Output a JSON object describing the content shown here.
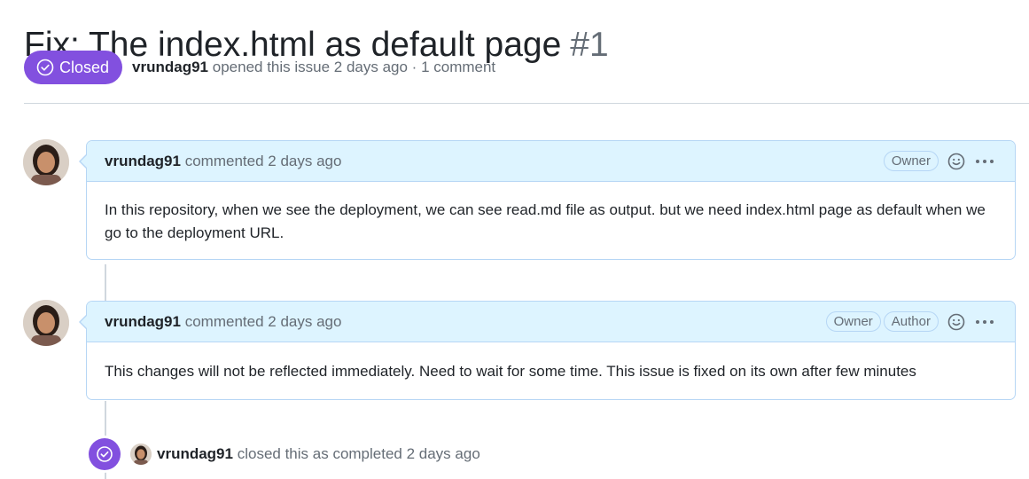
{
  "issue": {
    "title": "Fix: The index.html as default page",
    "number": "#1",
    "state": "Closed",
    "author": "vrundag91",
    "opened_text": "opened this issue 2 days ago · 1 comment"
  },
  "comments": [
    {
      "author": "vrundag91",
      "action": "commented 2 days ago",
      "labels": [
        "Owner"
      ],
      "body": "In this repository, when we see the deployment, we can see read.md file as output. but we need index.html page as default when we go to the deployment URL."
    },
    {
      "author": "vrundag91",
      "action": "commented 2 days ago",
      "labels": [
        "Owner",
        "Author"
      ],
      "body": "This changes will not be reflected immediately. Need to wait for some time. This issue is fixed on its own after few minutes"
    }
  ],
  "event": {
    "author": "vrundag91",
    "text": "closed this as completed 2 days ago"
  },
  "icons": {
    "state": "check-circle-icon",
    "reaction": "smiley-icon",
    "menu": "kebab-horizontal-icon"
  },
  "colors": {
    "closed_purple": "#8250df",
    "header_blue": "#ddf4ff",
    "border_blue": "#b6d6f5"
  }
}
